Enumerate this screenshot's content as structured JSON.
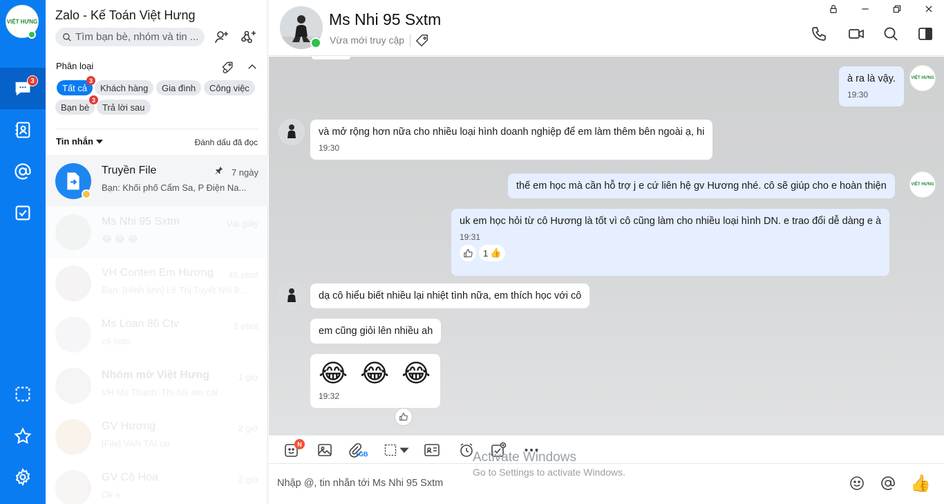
{
  "app": {
    "title": "Zalo - Kế Toán Việt Hưng",
    "brand_logo_text": "VIỆT HƯNG",
    "nav_badge_count": "3"
  },
  "search": {
    "placeholder": "Tìm bạn bè, nhóm và tin ..."
  },
  "categories": {
    "header": "Phân loại",
    "chips": [
      {
        "label": "Tất cả",
        "badge": "3",
        "active": true
      },
      {
        "label": "Khách hàng"
      },
      {
        "label": "Gia đình"
      },
      {
        "label": "Công việc"
      },
      {
        "label": "Bạn bè",
        "badge": "3"
      },
      {
        "label": "Trả lời sau"
      }
    ]
  },
  "inbox": {
    "filter_label": "Tin nhắn",
    "mark_read_label": "Đánh dấu đã đọc",
    "conversations": [
      {
        "name": "Truyền File",
        "time": "7 ngày",
        "preview": "Bạn: Khối phố Cẩm Sa, P Điện Na..."
      },
      {
        "name": "Ms Nhi 95 Sxtm",
        "time": "Vài giây",
        "preview": "😂 😂 😂"
      },
      {
        "name": "VH Conten Em Hương",
        "time": "46 phút",
        "preview": "Bạn: [Hình ảnh] Lê Thị Tuyết Nhi 9..."
      },
      {
        "name": "Ms Loan 86 Ctv",
        "time": "2 phút",
        "preview": "cô loan"
      },
      {
        "name": "Nhóm mờ Việt Hưng",
        "time": "1 giờ",
        "preview": "VH Ms Thanh: Thì hỏi em cái"
      },
      {
        "name": "GV Hương",
        "time": "2 giờ",
        "preview": "[File] VAN TAI.rar"
      },
      {
        "name": "GV Cô Hoa",
        "time": "2 giờ",
        "preview": "Ok e"
      }
    ]
  },
  "chat": {
    "contact_name": "Ms Nhi 95 Sxtm",
    "status": "Vừa mới truy cập",
    "composer_placeholder": "Nhập @, tin nhắn tới Ms Nhi 95 Sxtm",
    "file_quota": "1GB",
    "sticker_badge": "N",
    "messages": [
      {
        "text": "à ra là vậy.",
        "time": "19:30",
        "dir": "out"
      },
      {
        "text": "và mở rộng hơn nữa cho nhiều loại hình doanh nghiệp để em làm thêm bên ngoài ạ, hi",
        "time": "19:30",
        "dir": "in"
      },
      {
        "text": "thế em học mà cần hỗ trợ j e cứ liên hệ gv Hương nhé. cô sẽ giúp cho e hoàn thiện",
        "dir": "out"
      },
      {
        "text": "uk em học hỏi từ cô Hương là tốt vì cô cũng làm cho nhiều loại hình DN. e trao đổi dễ dàng e à",
        "time": "19:31",
        "dir": "out",
        "reaction_count": "1"
      },
      {
        "text": "dạ cô hiểu biết nhiều lại nhiệt tình nữa, em thích học với cô",
        "dir": "in"
      },
      {
        "text": "em cũng giỏi lên nhiều ah",
        "dir": "in"
      },
      {
        "text": "😂 😂 😂",
        "time": "19:32",
        "dir": "in"
      }
    ]
  },
  "watermark": {
    "line1": "Activate Windows",
    "line2": "Go to Settings to activate Windows."
  },
  "colors": {
    "accent": "#0a7cf2",
    "outgoing_bubble": "#e5efff",
    "badge": "#e53935",
    "online": "#2fc14a"
  }
}
